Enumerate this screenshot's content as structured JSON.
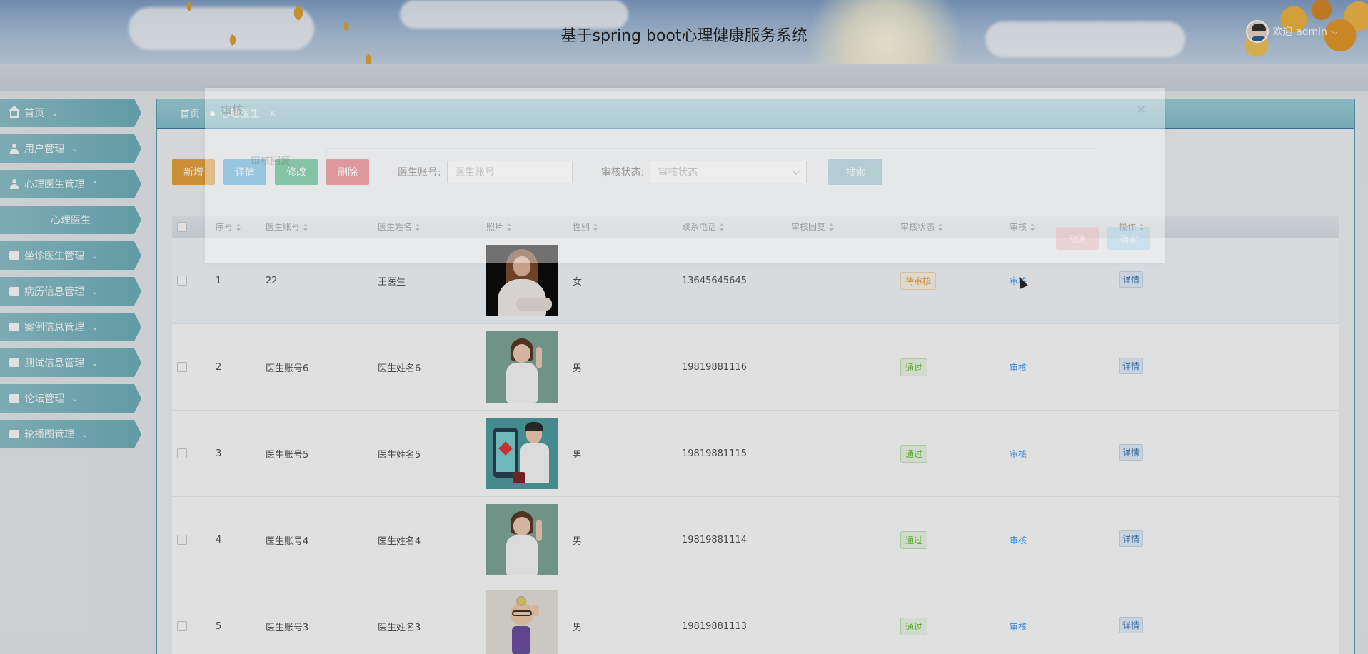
{
  "header": {
    "title": "基于spring boot心理健康服务系统",
    "welcome": "欢迎 admin"
  },
  "sidebar": {
    "items": [
      {
        "label": "首页",
        "icon": "home-icon"
      },
      {
        "label": "用户管理",
        "icon": "user-icon"
      },
      {
        "label": "心理医生管理",
        "icon": "user-icon"
      },
      {
        "label": "心理医生",
        "icon": ""
      },
      {
        "label": "坐诊医生管理",
        "icon": "briefcase-icon"
      },
      {
        "label": "病历信息管理",
        "icon": "folder-icon"
      },
      {
        "label": "案例信息管理",
        "icon": "archive-icon"
      },
      {
        "label": "测试信息管理",
        "icon": "chart-icon"
      },
      {
        "label": "论坛管理",
        "icon": "image-icon"
      },
      {
        "label": "轮播图管理",
        "icon": "folder-icon"
      }
    ]
  },
  "tabs": {
    "home": "首页",
    "current": "心理医生",
    "close": "×"
  },
  "toolbar": {
    "add": "新增",
    "detail": "详情",
    "modify": "修改",
    "delete": "删除",
    "account_label": "医生账号:",
    "account_placeholder": "医生账号",
    "status_label": "审核状态:",
    "status_placeholder": "审核状态",
    "search": "搜索"
  },
  "table": {
    "columns": [
      "序号",
      "医生账号",
      "医生姓名",
      "照片",
      "性别",
      "联系电话",
      "审核回复",
      "审核状态",
      "审核",
      "操作"
    ],
    "rows": [
      {
        "no": "1",
        "account": "22",
        "name": "王医生",
        "gender": "女",
        "phone": "13645645645",
        "reply": "",
        "status": "待审核",
        "review": "审核",
        "action": "详情"
      },
      {
        "no": "2",
        "account": "医生账号6",
        "name": "医生姓名6",
        "gender": "男",
        "phone": "19819881116",
        "reply": "",
        "status": "通过",
        "review": "审核",
        "action": "详情"
      },
      {
        "no": "3",
        "account": "医生账号5",
        "name": "医生姓名5",
        "gender": "男",
        "phone": "19819881115",
        "reply": "",
        "status": "通过",
        "review": "审核",
        "action": "详情"
      },
      {
        "no": "4",
        "account": "医生账号4",
        "name": "医生姓名4",
        "gender": "男",
        "phone": "19819881114",
        "reply": "",
        "status": "通过",
        "review": "审核",
        "action": "详情"
      },
      {
        "no": "5",
        "account": "医生账号3",
        "name": "医生姓名3",
        "gender": "男",
        "phone": "19819881113",
        "reply": "",
        "status": "通过",
        "review": "审核",
        "action": "详情"
      }
    ]
  },
  "modal": {
    "title": "审核",
    "close": "×",
    "label": "审核回复",
    "cancel": "取消",
    "confirm": "确定"
  },
  "colors": {
    "sidebar": "#7cb9c5",
    "add": "#e8a33d",
    "detail": "#58b4e8",
    "modify": "#35ad76",
    "delete": "#e25a60",
    "search": "#8fc3cc",
    "pending": "#e6a23c",
    "pass": "#67c23a"
  }
}
